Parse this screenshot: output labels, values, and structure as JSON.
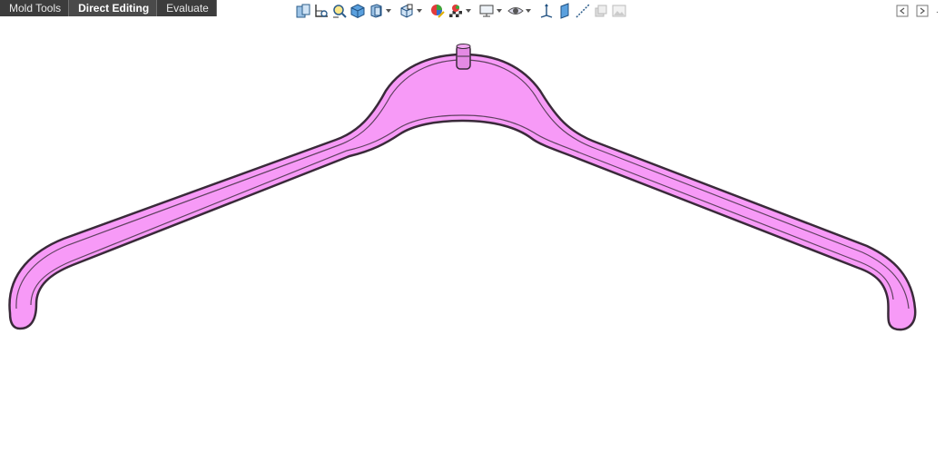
{
  "tabs": [
    {
      "label": "Mold Tools",
      "active": false
    },
    {
      "label": "Direct Editing",
      "active": true
    },
    {
      "label": "Evaluate",
      "active": false
    }
  ],
  "heads_up_toolbar": [
    "zoom-to-fit-icon",
    "zoom-to-area-icon",
    "previous-view-icon",
    "section-view-icon",
    "view-orientation-icon",
    "display-style-icon",
    "hide-show-items-icon",
    "edit-appearance-icon",
    "apply-scene-icon",
    "view-settings-icon",
    "hide-show-icon",
    "view-axes-icon",
    "view-planes-icon",
    "view-sketches-icon",
    "view-layers-icon",
    "view-image-icon"
  ],
  "viewport": {
    "model": "clothes-hanger",
    "body_color": "#f79af7",
    "edge_color": "#3a2a3a",
    "background": "#ffffff"
  },
  "window_controls": [
    "panel-left-icon",
    "panel-right-icon",
    "more-icon"
  ],
  "colors": {
    "tab_bar": "#3c3c3c",
    "accent": "#f79af7"
  }
}
